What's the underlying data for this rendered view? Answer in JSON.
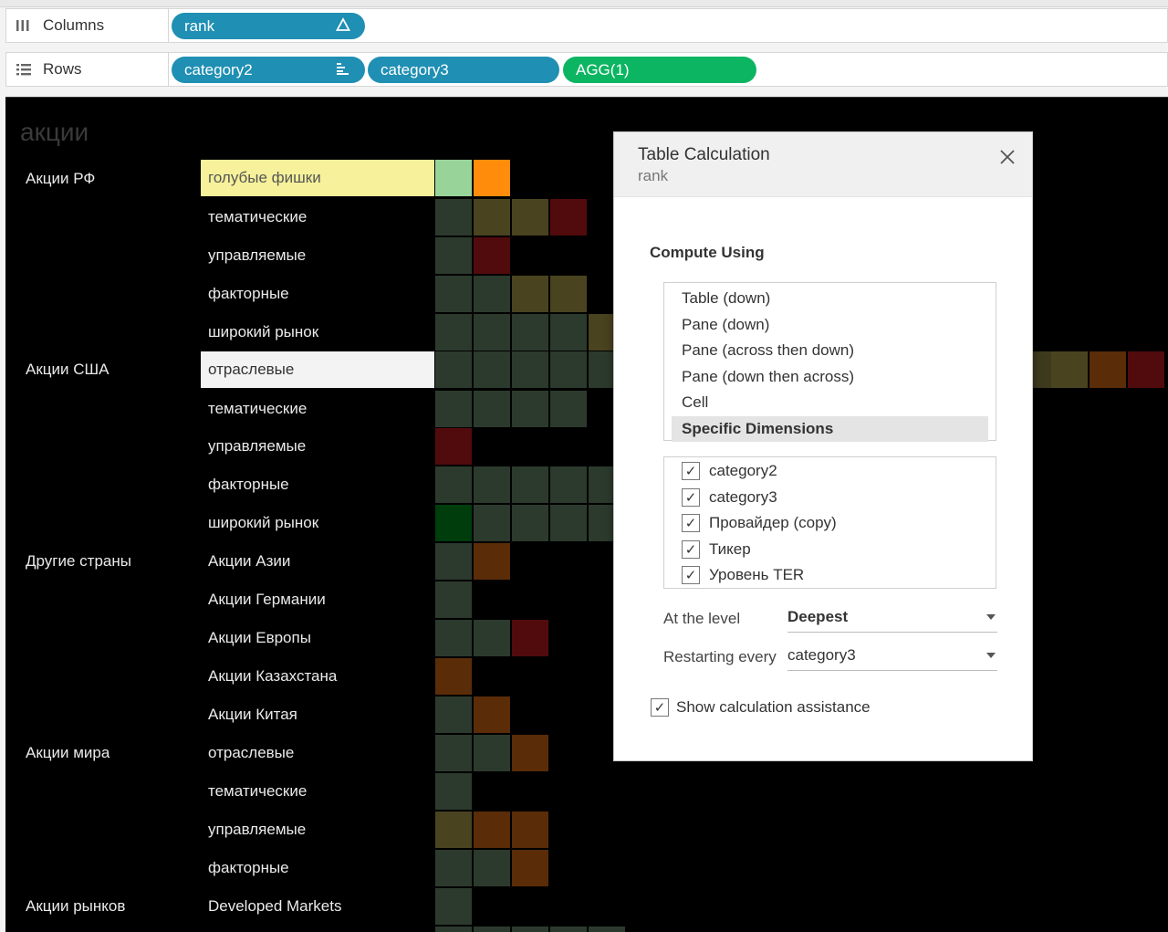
{
  "shelves": {
    "columns": {
      "label": "Columns",
      "icon": "columns-icon",
      "pills": [
        {
          "text": "rank",
          "icon": "delta-icon"
        }
      ]
    },
    "rows": {
      "label": "Rows",
      "icon": "rows-icon",
      "pills": [
        {
          "text": "category2",
          "icon": "sort-icon"
        },
        {
          "text": "category3"
        },
        {
          "text": "AGG(1)"
        }
      ]
    }
  },
  "viz": {
    "title": "акции",
    "category2": [
      "Акции РФ",
      "Акции США",
      "Другие страны",
      "Акции мира",
      "Акции рынков"
    ],
    "category3": [
      "голубые фишки",
      "тематические",
      "управляемые",
      "факторные",
      "широкий рынок",
      "отраслевые",
      "тематические",
      "управляемые",
      "факторные",
      "широкий рынок",
      "Акции Азии",
      "Акции Германии",
      "Акции Европы",
      "Акции Казахстана",
      "Акции Китая",
      "отраслевые",
      "тематические",
      "управляемые",
      "факторные",
      "Developed Markets"
    ],
    "colors": {
      "light_green": "#98d49a",
      "orange": "#ff8c0a",
      "dark_gray": "#2c3a2d",
      "olive": "#4a4320",
      "dark_red": "#520b0d",
      "brown": "#5a2c08",
      "dark_green": "#003d0c",
      "highlight_yellow": "#f6f19a"
    }
  },
  "dialog": {
    "title": "Table Calculation",
    "subtitle": "rank",
    "compute_using_label": "Compute Using",
    "options": [
      "Table (down)",
      "Pane (down)",
      "Pane (across then down)",
      "Pane (down then across)",
      "Cell",
      "Specific Dimensions"
    ],
    "selected_option": "Specific Dimensions",
    "dimensions": [
      "category2",
      "category3",
      "Провайдер (copy)",
      "Тикер",
      "Уровень TER"
    ],
    "at_level_label": "At the level",
    "at_level_value": "Deepest",
    "restarting_label": "Restarting every",
    "restarting_value": "category3",
    "show_assist_label": "Show calculation assistance"
  }
}
